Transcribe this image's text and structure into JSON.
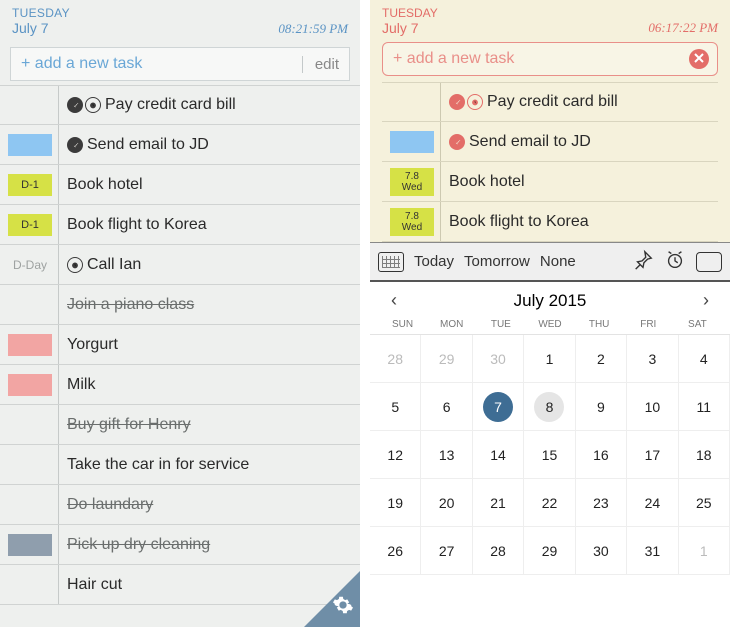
{
  "left": {
    "day": "TUESDAY",
    "date": "July 7",
    "time": "08:21:59 PM",
    "add_placeholder": "+ add a new task",
    "edit_label": "edit",
    "tasks": [
      {
        "tag": "",
        "tag_style": "empty",
        "pin": true,
        "alarm": true,
        "text": "Pay credit card bill",
        "done": false
      },
      {
        "tag": "",
        "tag_style": "blue",
        "pin": true,
        "alarm": false,
        "text": "Send email to JD",
        "done": false
      },
      {
        "tag": "D-1",
        "tag_style": "yellow",
        "pin": false,
        "alarm": false,
        "text": "Book hotel",
        "done": false
      },
      {
        "tag": "D-1",
        "tag_style": "yellow",
        "pin": false,
        "alarm": false,
        "text": "Book flight to Korea",
        "done": false
      },
      {
        "tag": "D-Day",
        "tag_style": "gray",
        "pin": false,
        "alarm": true,
        "text": "Call Ian",
        "done": false
      },
      {
        "tag": "",
        "tag_style": "empty",
        "pin": false,
        "alarm": false,
        "text": "Join a piano class",
        "done": true
      },
      {
        "tag": "",
        "tag_style": "pink",
        "pin": false,
        "alarm": false,
        "text": "Yorgurt",
        "done": false
      },
      {
        "tag": "",
        "tag_style": "pink",
        "pin": false,
        "alarm": false,
        "text": "Milk",
        "done": false
      },
      {
        "tag": "",
        "tag_style": "empty",
        "pin": false,
        "alarm": false,
        "text": "Buy gift for Henry",
        "done": true
      },
      {
        "tag": "",
        "tag_style": "empty",
        "pin": false,
        "alarm": false,
        "text": "Take the car in for service",
        "done": false
      },
      {
        "tag": "",
        "tag_style": "empty",
        "pin": false,
        "alarm": false,
        "text": "Do laundary",
        "done": true
      },
      {
        "tag": "",
        "tag_style": "slate",
        "pin": false,
        "alarm": false,
        "text": "Pick up dry cleaning",
        "done": true
      },
      {
        "tag": "",
        "tag_style": "empty",
        "pin": false,
        "alarm": false,
        "text": "Hair cut",
        "done": false
      }
    ]
  },
  "right": {
    "day": "TUESDAY",
    "date": "July 7",
    "time": "06:17:22 PM",
    "add_placeholder": "+ add a new task",
    "tasks": [
      {
        "tag1": "",
        "tag2": "",
        "tag_style": "empty",
        "pin": true,
        "alarm": true,
        "text": "Pay credit card bill"
      },
      {
        "tag1": "",
        "tag2": "",
        "tag_style": "blue",
        "pin": true,
        "alarm": false,
        "text": "Send email to JD"
      },
      {
        "tag1": "7.8",
        "tag2": "Wed",
        "tag_style": "yellow",
        "pin": false,
        "alarm": false,
        "text": "Book hotel"
      },
      {
        "tag1": "7.8",
        "tag2": "Wed",
        "tag_style": "yellow",
        "pin": false,
        "alarm": false,
        "text": "Book flight to Korea"
      }
    ],
    "toolbar": {
      "today": "Today",
      "tomorrow": "Tomorrow",
      "none": "None"
    },
    "calendar": {
      "title": "July 2015",
      "dow": [
        "SUN",
        "MON",
        "TUE",
        "WED",
        "THU",
        "FRI",
        "SAT"
      ],
      "cells": [
        {
          "n": "28",
          "dim": true
        },
        {
          "n": "29",
          "dim": true
        },
        {
          "n": "30",
          "dim": true
        },
        {
          "n": "1"
        },
        {
          "n": "2"
        },
        {
          "n": "3"
        },
        {
          "n": "4"
        },
        {
          "n": "5"
        },
        {
          "n": "6"
        },
        {
          "n": "7",
          "sel": true
        },
        {
          "n": "8",
          "today": true
        },
        {
          "n": "9"
        },
        {
          "n": "10"
        },
        {
          "n": "11"
        },
        {
          "n": "12"
        },
        {
          "n": "13"
        },
        {
          "n": "14"
        },
        {
          "n": "15"
        },
        {
          "n": "16"
        },
        {
          "n": "17"
        },
        {
          "n": "18"
        },
        {
          "n": "19"
        },
        {
          "n": "20"
        },
        {
          "n": "21"
        },
        {
          "n": "22"
        },
        {
          "n": "23"
        },
        {
          "n": "24"
        },
        {
          "n": "25"
        },
        {
          "n": "26"
        },
        {
          "n": "27"
        },
        {
          "n": "28"
        },
        {
          "n": "29"
        },
        {
          "n": "30"
        },
        {
          "n": "31"
        },
        {
          "n": "1",
          "dim": true
        }
      ]
    }
  }
}
